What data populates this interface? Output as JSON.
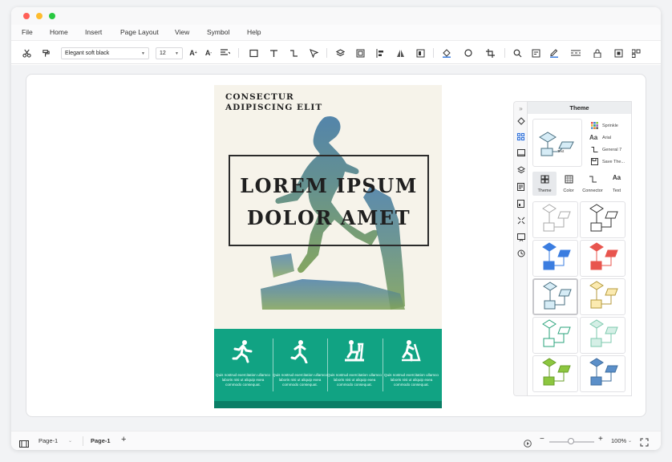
{
  "window": {
    "traffic_lights": [
      "#ff5f57",
      "#febc2e",
      "#28c840"
    ]
  },
  "menu": {
    "items": [
      "File",
      "Home",
      "Insert",
      "Page Layout",
      "View",
      "Symbol",
      "Help"
    ]
  },
  "toolbar": {
    "font_name": "Elegant soft black",
    "font_size": "12",
    "icons": [
      "scissors-icon",
      "format-painter-icon",
      "font-grow-icon",
      "font-shrink-icon",
      "align-icon",
      "rectangle-icon",
      "text-icon",
      "connector-icon",
      "pointer-icon",
      "layers-icon",
      "group-icon",
      "align-left-icon",
      "flip-icon",
      "distribute-icon",
      "fill-color-icon",
      "line-color-icon",
      "crop-icon",
      "search-icon",
      "outline-icon",
      "pen-icon",
      "line-style-icon",
      "lock-icon",
      "frame-icon",
      "more-icon"
    ]
  },
  "poster": {
    "subtitle_line1": "CONSECTUR",
    "subtitle_line2": "ADIPISCING ELIT",
    "title_line1": "LOREM IPSUM",
    "title_line2": "DOLOR AMET",
    "accent_color": "#11a383",
    "columns": [
      {
        "icon": "runner-icon",
        "text": "Quis nostrud exercitation ullamco laboris nisi ut aliquip exea commodo consequat."
      },
      {
        "icon": "runner-icon",
        "text": "Quis nostrud exercitation ullamco laboris nisi ut aliquip exea commodo consequat."
      },
      {
        "icon": "stationary-bike-icon",
        "text": "Quis nostrud exercitation ullamco laboris nisi ut aliquip exea commodo consequat."
      },
      {
        "icon": "treadmill-icon",
        "text": "Quis nostrud exercitation ullamco laboris nisi ut aliquip exea commodo consequat."
      }
    ]
  },
  "side_rail": {
    "icons": [
      "collapse-icon",
      "fill-icon",
      "theme-icon",
      "image-icon",
      "layers-icon",
      "page-icon",
      "data-icon",
      "fit-icon",
      "present-icon",
      "history-icon"
    ]
  },
  "theme_panel": {
    "title": "Theme",
    "preview_text": "Text",
    "options": [
      {
        "icon": "color-grid-icon",
        "label": "Sprinkle"
      },
      {
        "icon": "font-icon",
        "label": "Arial"
      },
      {
        "icon": "connector-icon",
        "label": "General 7"
      },
      {
        "icon": "save-icon",
        "label": "Save The..."
      }
    ],
    "tabs": [
      "Theme",
      "Color",
      "Connector",
      "Text"
    ],
    "swatches": [
      {
        "a": "#ffffff",
        "b": "#ffffff",
        "stroke": "#aaaaaa"
      },
      {
        "a": "#ffffff",
        "b": "#ffffff",
        "stroke": "#333333"
      },
      {
        "a": "#3b7de0",
        "b": "#3b7de0",
        "stroke": "#3b7de0"
      },
      {
        "a": "#e8554e",
        "b": "#e8554e",
        "stroke": "#e8554e"
      },
      {
        "a": "#d6ecf6",
        "b": "#d6ecf6",
        "stroke": "#4a6f80"
      },
      {
        "a": "#fbeab0",
        "b": "#fbeab0",
        "stroke": "#b59a3c"
      },
      {
        "a": "#ffffff",
        "b": "#ffffff",
        "stroke": "#2aa37b"
      },
      {
        "a": "#d5efe6",
        "b": "#d5efe6",
        "stroke": "#7cc9ae"
      },
      {
        "a": "#8cc63f",
        "b": "#8cc63f",
        "stroke": "#6a9f2a"
      },
      {
        "a": "#5b8fc9",
        "b": "#5b8fc9",
        "stroke": "#3e6d9e"
      }
    ]
  },
  "status": {
    "page_select": "Page-1",
    "page_tab": "Page-1",
    "zoom": "100%"
  }
}
